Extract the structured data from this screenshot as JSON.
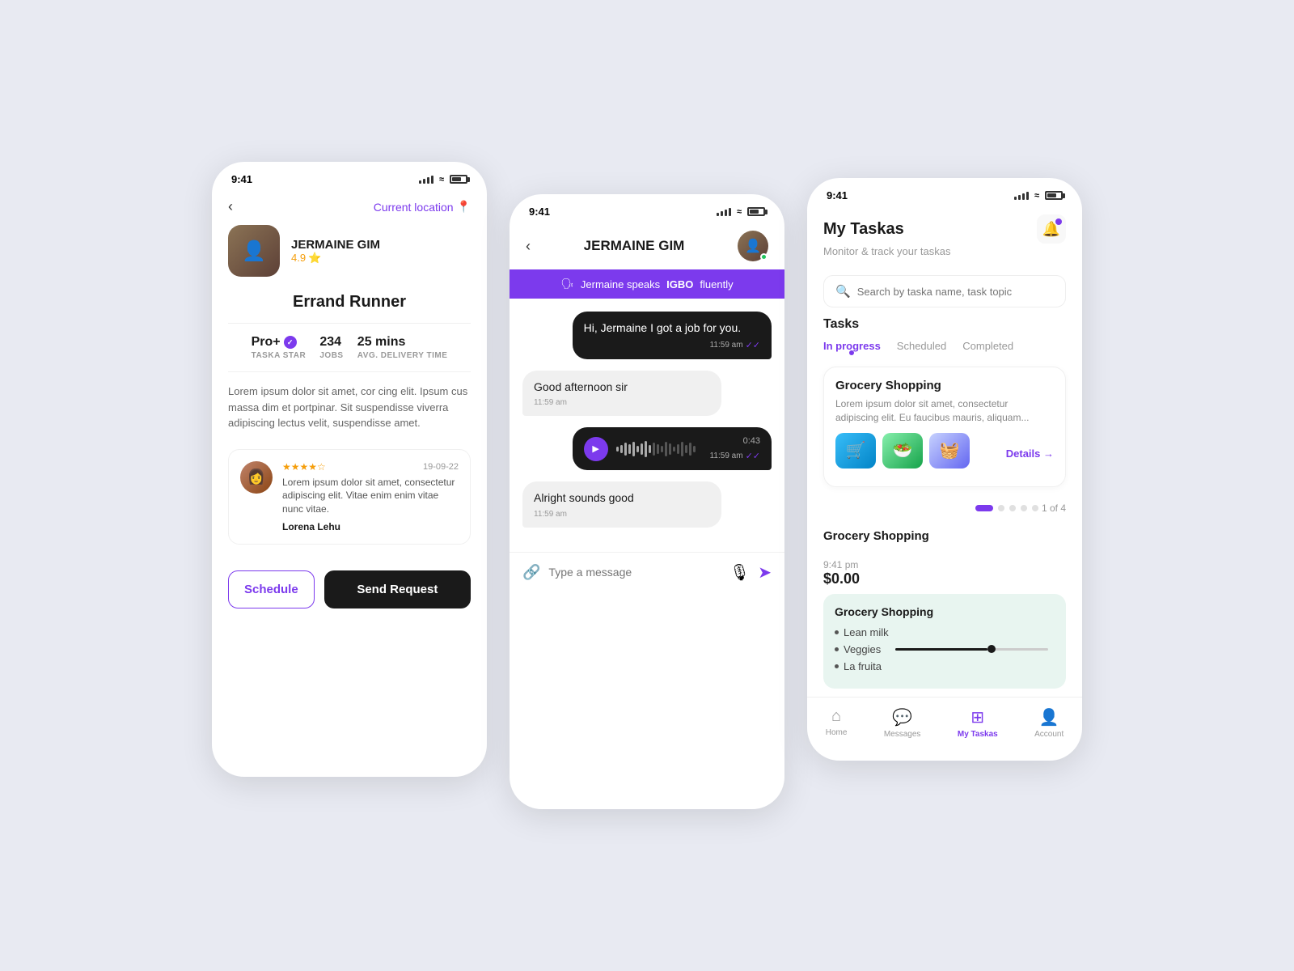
{
  "screen1": {
    "status_time": "9:41",
    "back_label": "‹",
    "current_location": "Current location",
    "location_pin": "📍",
    "profile_name": "JERMAINE GIM",
    "rating": "4.9",
    "rating_star": "⭐",
    "role": "Errand Runner",
    "badge": "Pro+",
    "badge_check": "✓",
    "jobs_count": "234",
    "jobs_label": "JOBS",
    "avg_time": "25 mins",
    "avg_label": "AVG. DELIVERY TIME",
    "star_label": "TASKA STAR",
    "bio": "Lorem ipsum dolor sit amet, cor cing elit. Ipsum cus massa dim et portpinar. Sit suspendisse viverra adipiscing lectus velit, suspendisse amet.",
    "review_stars": "★★★★☆",
    "review_date": "19-09-22",
    "review_text": "Lorem ipsum dolor sit amet, consectetur adipiscing elit. Vitae enim enim vitae nunc vitae.",
    "reviewer_name": "Lorena Lehu",
    "schedule_btn": "Schedule",
    "send_btn": "Send Request"
  },
  "screen2": {
    "status_time": "9:41",
    "back_label": "‹",
    "chat_name": "JERMAINE GIM",
    "language_banner": "Jermaine speaks ",
    "language_bold": "IGBO",
    "language_suffix": " fluently",
    "msg1_text": "Hi, Jermaine I got a job for you.",
    "msg1_time": "11:59 am",
    "msg2_text": "Good afternoon sir",
    "msg2_time": "11:59 am",
    "audio_duration": "0:43",
    "audio_time": "11:59 am",
    "msg3_text": "Alright sounds good",
    "msg3_time": "11:59 am",
    "input_placeholder": "Type a message"
  },
  "screen3": {
    "status_time": "9:41",
    "title": "My Taskas",
    "subtitle": "Monitor & track your taskas",
    "search_placeholder": "Search by taska name, task topic",
    "tasks_title": "Tasks",
    "tab_inprogress": "In progress",
    "tab_scheduled": "Scheduled",
    "tab_completed": "Completed",
    "task_title": "Grocery Shopping",
    "task_desc": "Lorem ipsum dolor sit amet, consectetur adipiscing elit. Eu faucibus mauris, aliquam...",
    "details_btn": "Details →",
    "pagination": "1 of 4",
    "grocery_section_title": "Grocery Shopping",
    "grocery_card_title": "Grocery Shopping",
    "grocery_item1": "Lean milk",
    "grocery_item2": "Veggies",
    "grocery_item3": "La fruita",
    "price_time": "9:41 pm",
    "price_amount": "$0.00",
    "nav_home": "Home",
    "nav_messages": "Messages",
    "nav_mytaskas": "My Taskas",
    "nav_account": "Account"
  }
}
